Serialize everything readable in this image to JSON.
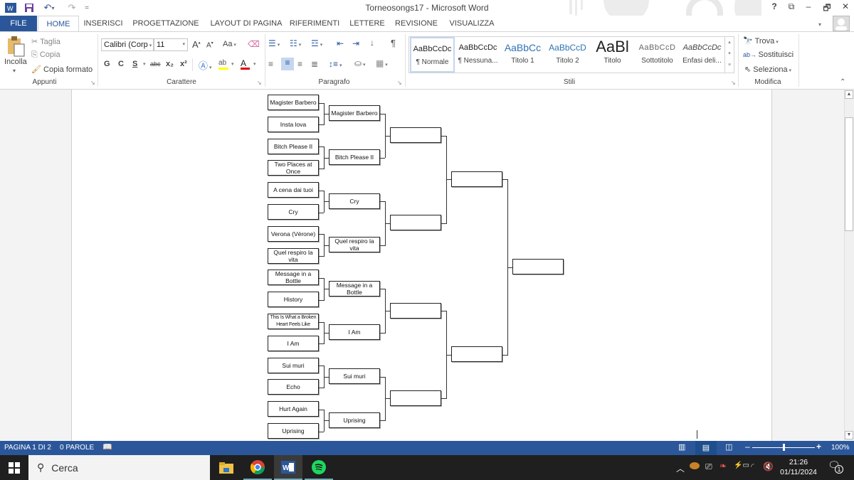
{
  "window": {
    "title": "Torneosongs17 - Microsoft Word",
    "controls": {
      "help": "?",
      "ribbon_display": "⧉",
      "minimize": "–",
      "restore": "🗗",
      "close": "✕"
    }
  },
  "quick_access": {
    "save_icon": "save-icon",
    "undo_icon": "undo-icon",
    "redo_icon": "redo-icon",
    "customize": "="
  },
  "tabs": [
    {
      "label": "FILE"
    },
    {
      "label": "HOME"
    },
    {
      "label": "INSERISCI"
    },
    {
      "label": "PROGETTAZIONE"
    },
    {
      "label": "LAYOUT DI PAGINA"
    },
    {
      "label": "RIFERIMENTI"
    },
    {
      "label": "LETTERE"
    },
    {
      "label": "REVISIONE"
    },
    {
      "label": "VISUALIZZA"
    }
  ],
  "ribbon": {
    "clipboard": {
      "group_label": "Appunti",
      "paste": "Incolla",
      "cut": "Taglia",
      "copy": "Copia",
      "format_painter": "Copia formato"
    },
    "font": {
      "group_label": "Carattere",
      "font_name": "Calibri (Corp",
      "font_size": "11",
      "grow": "A",
      "shrink": "A",
      "case": "Aa",
      "bold": "G",
      "italic": "C",
      "underline": "S",
      "strikethrough": "abc",
      "subscript": "x₂",
      "superscript": "x²",
      "highlight_color": "#ffff00",
      "font_color": "#e00000"
    },
    "paragraph": {
      "group_label": "Paragrafo",
      "pilcrow": "¶"
    },
    "styles": {
      "group_label": "Stili",
      "items": [
        {
          "sample": "AaBbCcDc",
          "name": "¶ Normale",
          "selected": true
        },
        {
          "sample": "AaBbCcDc",
          "name": "¶ Nessuna..."
        },
        {
          "sample": "AaBbCc",
          "name": "Titolo 1"
        },
        {
          "sample": "AaBbCcD",
          "name": "Titolo 2"
        },
        {
          "sample": "AaBl",
          "name": "Titolo"
        },
        {
          "sample": "AaBbCcD",
          "name": "Sottotitolo"
        },
        {
          "sample": "AaBbCcDc",
          "name": "Enfasi deli..."
        }
      ]
    },
    "editing": {
      "group_label": "Modifica",
      "find": "Trova",
      "replace": "Sostituisci",
      "select": "Seleziona"
    }
  },
  "bracket": {
    "round1": [
      "Magister Barbero",
      "Insta lova",
      "Bitch Please II",
      "Two Places at Once",
      "A cena dai tuoi",
      "Cry",
      "Verona (Vérone)",
      "Quel respiro la vita",
      "Message in a Bottle",
      "History",
      "This Is What a Broken Heart Feels Like",
      "I Am",
      "Sui muri",
      "Echo",
      "Hurt Again",
      "Uprising"
    ],
    "round2": [
      "Magister Barbero",
      "Bitch Please II",
      "Cry",
      "Quel respiro la vita",
      "Message in a Bottle",
      "I Am",
      "Sui muri",
      "Uprising"
    ],
    "round3": [
      "",
      "",
      "",
      ""
    ],
    "round4": [
      "",
      ""
    ],
    "final": [
      ""
    ]
  },
  "statusbar": {
    "page": "PAGINA 1 DI 2",
    "words": "0 PAROLE",
    "zoom": "100%",
    "zoom_fraction": 0.5
  },
  "taskbar": {
    "search_placeholder": "Cerca",
    "apps": [
      "file-explorer",
      "chrome",
      "word",
      "spotify"
    ],
    "time": "21:26",
    "date": "01/11/2024",
    "notifications": "1"
  },
  "colors": {
    "accent": "#2b579a",
    "taskbar": "#1f1f1f"
  }
}
